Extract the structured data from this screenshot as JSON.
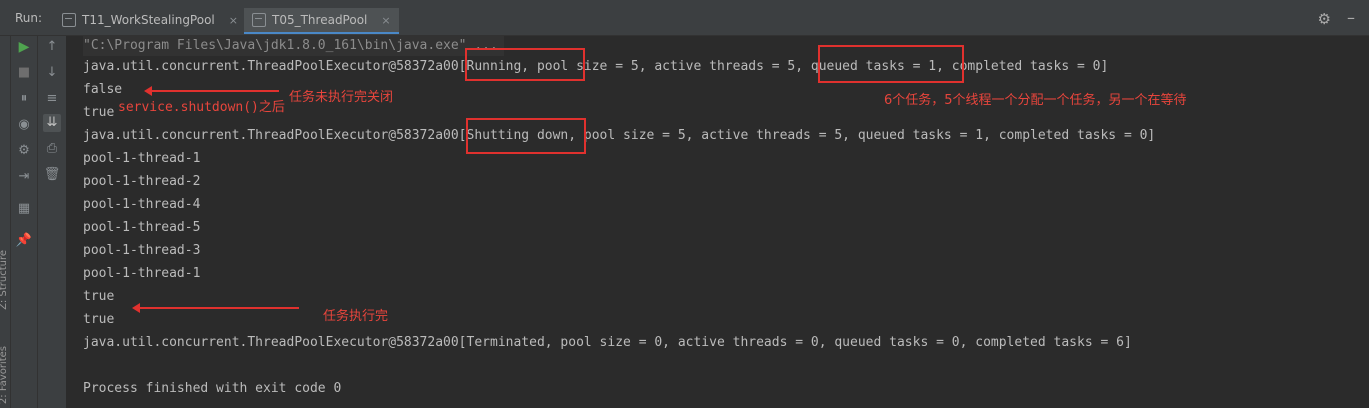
{
  "header": {
    "run_label": "Run:",
    "tabs": [
      {
        "label": "T11_WorkStealingPool",
        "close": "×"
      },
      {
        "label": "T05_ThreadPool",
        "close": "×"
      }
    ],
    "gear": "⚙",
    "minimize": "–"
  },
  "side": {
    "structure_label": "Z: Structure",
    "favorites_label": "2: Favorites"
  },
  "toolbar": {
    "run": "▶",
    "stop": "■",
    "pause": "⏸",
    "camera": "◉",
    "settings": "⚙",
    "exit": "⇥",
    "layout": "▦",
    "pin": "📌",
    "up": "↑",
    "down": "↓",
    "soft_wrap": "≡",
    "scroll_end": "⇊",
    "print": "⎙",
    "trash": "🗑"
  },
  "console": {
    "lines": [
      "\"C:\\Program Files\\Java\\jdk1.8.0_161\\bin\\java.exe\" ...",
      "java.util.concurrent.ThreadPoolExecutor@58372a00[Running, pool size = 5, active threads = 5, queued tasks = 1, completed tasks = 0]",
      "false",
      "true",
      "java.util.concurrent.ThreadPoolExecutor@58372a00[Shutting down, pool size = 5, active threads = 5, queued tasks = 1, completed tasks = 0]",
      "pool-1-thread-1",
      "pool-1-thread-2",
      "pool-1-thread-4",
      "pool-1-thread-5",
      "pool-1-thread-3",
      "pool-1-thread-1",
      "true",
      "true",
      "java.util.concurrent.ThreadPoolExecutor@58372a00[Terminated, pool size = 0, active threads = 0, queued tasks = 0, completed tasks = 6]",
      "",
      "Process finished with exit code 0"
    ]
  },
  "annotations": {
    "shutdown_call": "service.shutdown()之后",
    "not_finished": "任务未执行完关闭",
    "queue_note": "6个任务，5个线程一个分配一个任务，另一个在等待",
    "finished": "任务执行完"
  },
  "colors": {
    "background": "#2b2b2b",
    "toolbar": "#3c3f41",
    "text": "#bbbbbb",
    "annotation": "#e0312e",
    "run_green": "#4fa34f"
  }
}
